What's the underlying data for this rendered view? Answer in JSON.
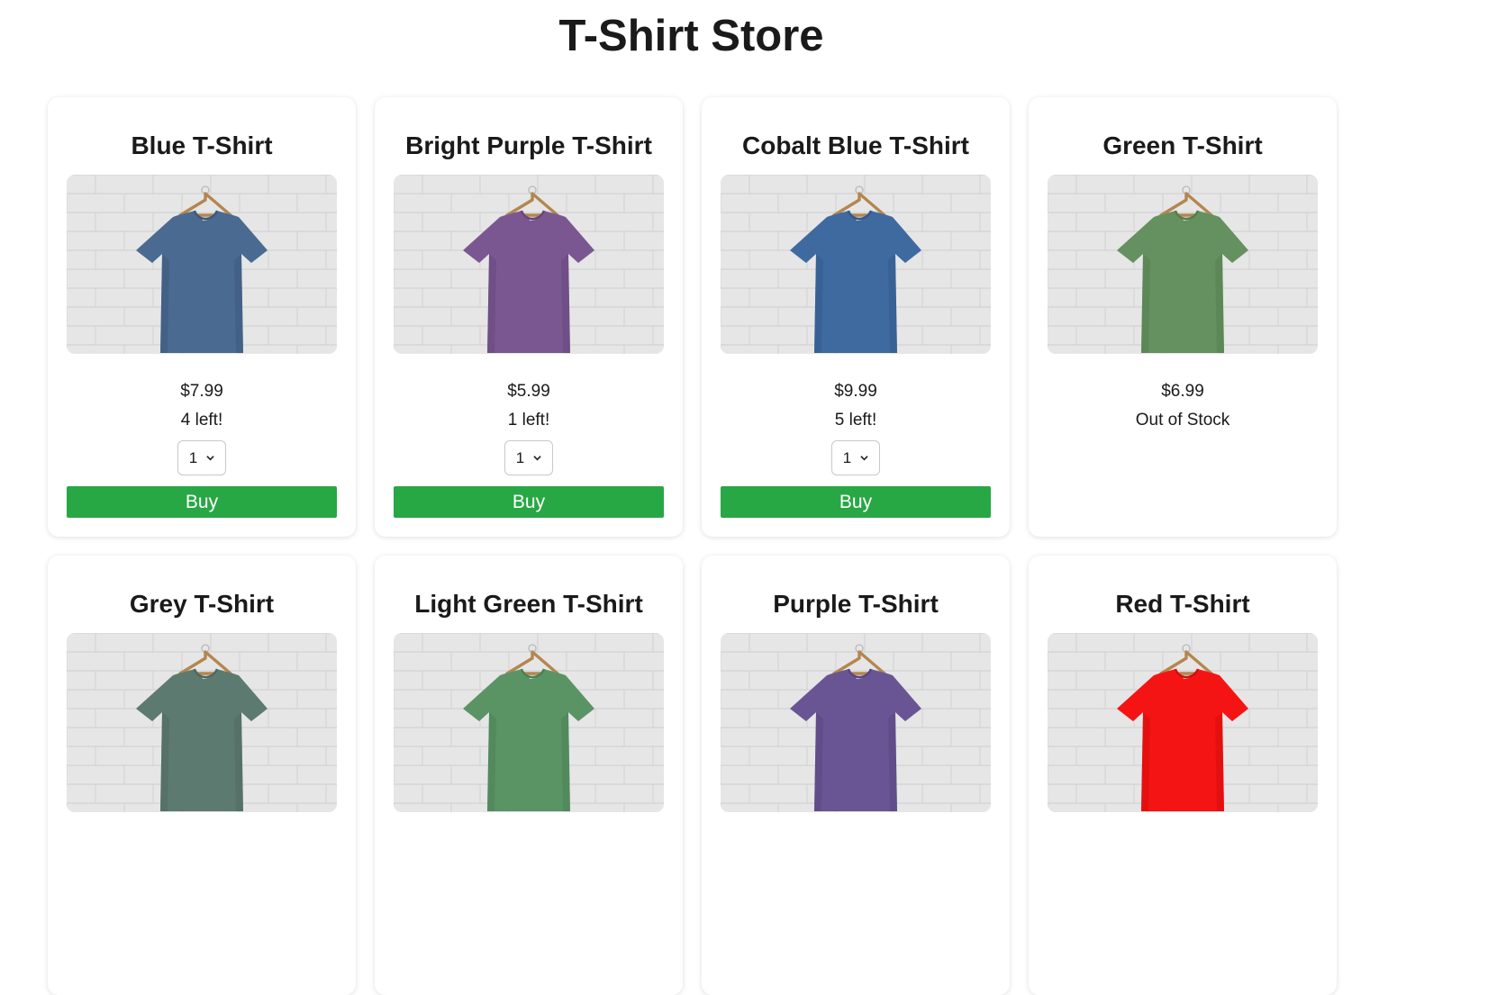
{
  "page": {
    "title": "T-Shirt Store"
  },
  "products": [
    {
      "name": "Blue T-Shirt",
      "price": "$7.99",
      "stock": "4 left!",
      "in_stock": true,
      "quantity": "1",
      "buy_label": "Buy",
      "shirt_color": "#4a6a92",
      "shirt_shade": "#3b587c"
    },
    {
      "name": "Bright Purple T-Shirt",
      "price": "$5.99",
      "stock": "1 left!",
      "in_stock": true,
      "quantity": "1",
      "buy_label": "Buy",
      "shirt_color": "#7b5792",
      "shirt_shade": "#664679"
    },
    {
      "name": "Cobalt Blue T-Shirt",
      "price": "$9.99",
      "stock": "5 left!",
      "in_stock": true,
      "quantity": "1",
      "buy_label": "Buy",
      "shirt_color": "#3f6aa0",
      "shirt_shade": "#325889"
    },
    {
      "name": "Green T-Shirt",
      "price": "$6.99",
      "stock": "Out of Stock",
      "in_stock": false,
      "quantity": "",
      "buy_label": "",
      "shirt_color": "#65905f",
      "shirt_shade": "#547d4f"
    },
    {
      "name": "Grey T-Shirt",
      "price": "",
      "stock": "",
      "in_stock": true,
      "quantity": "",
      "buy_label": "",
      "shirt_color": "#5d7a70",
      "shirt_shade": "#4d685f"
    },
    {
      "name": "Light Green T-Shirt",
      "price": "",
      "stock": "",
      "in_stock": true,
      "quantity": "",
      "buy_label": "",
      "shirt_color": "#5a9465",
      "shirt_shade": "#4a8055"
    },
    {
      "name": "Purple T-Shirt",
      "price": "",
      "stock": "",
      "in_stock": true,
      "quantity": "",
      "buy_label": "",
      "shirt_color": "#6a5594",
      "shirt_shade": "#58457e"
    },
    {
      "name": "Red T-Shirt",
      "price": "",
      "stock": "",
      "in_stock": true,
      "quantity": "",
      "buy_label": "",
      "shirt_color": "#f51414",
      "shirt_shade": "#d30c0c"
    }
  ],
  "colors": {
    "buy_button": "#28a745",
    "wall": "#e6e6e6"
  }
}
